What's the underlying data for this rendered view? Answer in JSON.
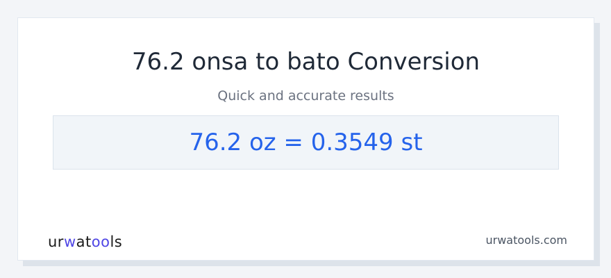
{
  "card": {
    "title": "76.2 onsa to bato Conversion",
    "subtitle": "Quick and accurate results",
    "result": "76.2 oz = 0.3549 st"
  },
  "footer": {
    "logo_parts": [
      "ur",
      "w",
      "at",
      "oo",
      "ls"
    ],
    "site": "urwatools.com"
  },
  "colors": {
    "result_text": "#2563eb",
    "result_bg": "#f1f5f9",
    "logo_accent": "#4f46e5"
  }
}
